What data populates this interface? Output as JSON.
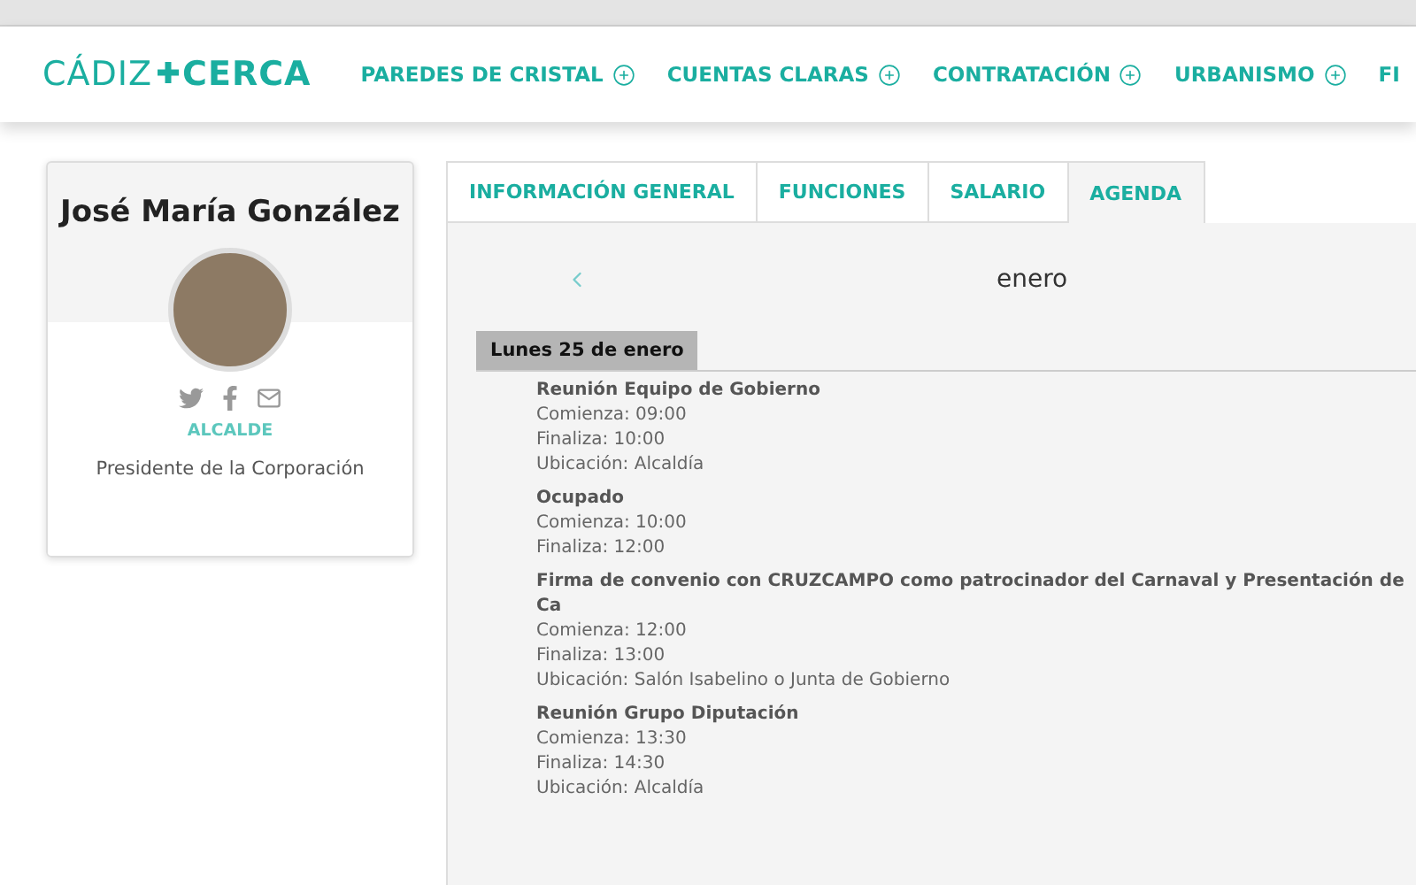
{
  "logo": {
    "light": "CÁDIZ",
    "bold": "CERCA"
  },
  "nav": [
    {
      "label": "PAREDES DE CRISTAL"
    },
    {
      "label": "CUENTAS CLARAS"
    },
    {
      "label": "CONTRATACIÓN"
    },
    {
      "label": "URBANISMO"
    },
    {
      "label": "FI"
    }
  ],
  "profile": {
    "name": "José María González",
    "role": "ALCALDE",
    "description": "Presidente de la Corporación"
  },
  "tabs": [
    {
      "label": "INFORMACIÓN GENERAL",
      "selected": false
    },
    {
      "label": "FUNCIONES",
      "selected": false
    },
    {
      "label": "SALARIO",
      "selected": false
    },
    {
      "label": "AGENDA",
      "selected": true
    }
  ],
  "calendar": {
    "month": "enero",
    "day": "Lunes 25 de enero"
  },
  "events": [
    {
      "title": "Reunión Equipo de Gobierno",
      "lines": [
        "Comienza: 09:00",
        "Finaliza: 10:00",
        "Ubicación: Alcaldía"
      ]
    },
    {
      "title": "Ocupado",
      "lines": [
        "Comienza: 10:00",
        "Finaliza: 12:00"
      ]
    },
    {
      "title": "Firma de convenio con CRUZCAMPO como patrocinador del Carnaval y Presentación de Ca",
      "lines": [
        "Comienza: 12:00",
        "Finaliza: 13:00",
        "Ubicación: Salón Isabelino o Junta de Gobierno"
      ]
    },
    {
      "title": "Reunión Grupo Diputación",
      "lines": [
        "Comienza: 13:30",
        "Finaliza: 14:30",
        "Ubicación: Alcaldía"
      ]
    }
  ]
}
